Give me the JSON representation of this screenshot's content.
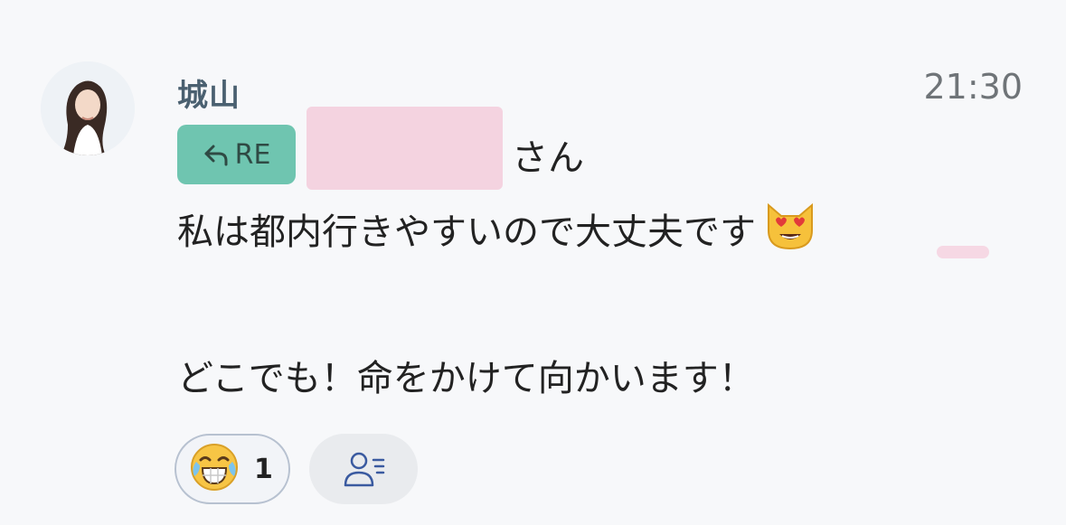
{
  "message": {
    "sender": "城山",
    "time": "21:30",
    "reply_badge": "RE",
    "mention_suffix": "さん",
    "line1": "私は都内行きやすいので大丈夫です",
    "line2": "どこでも！命をかけて向かいます！"
  },
  "reactions": [
    {
      "emoji": "crying-laughing-face-icon",
      "count": "1"
    }
  ],
  "icons": {
    "reply": "reply-arrow-icon",
    "inline_emoji": "heart-eyes-cat-icon",
    "readers": "read-members-icon"
  },
  "colors": {
    "background": "#f7f8fa",
    "sender": "#4a6070",
    "re_badge": "#6fc5b0",
    "redaction": "#f4d3e0",
    "reaction_border": "#b7c1d0"
  }
}
